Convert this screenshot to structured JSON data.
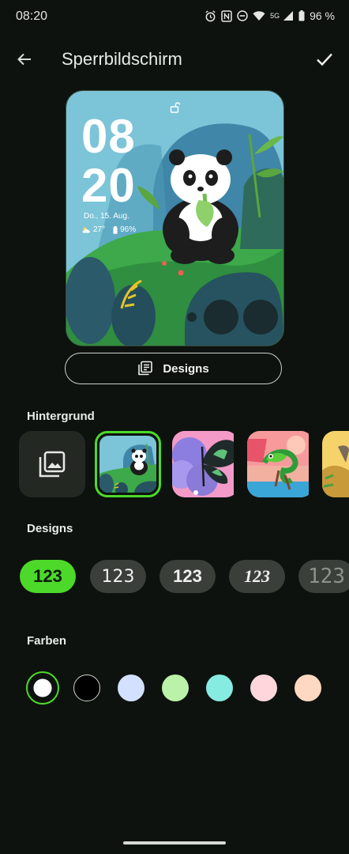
{
  "status_bar": {
    "time": "08:20",
    "network": "5G",
    "battery": "96 %"
  },
  "app_bar": {
    "title": "Sperrbildschirm"
  },
  "preview": {
    "hour": "08",
    "minute": "20",
    "date": "Do., 15. Aug.",
    "temperature": "27°",
    "battery": "96%"
  },
  "designs_button": {
    "label": "Designs"
  },
  "sections": {
    "background": "Hintergrund",
    "designs": "Designs",
    "colors": "Farben"
  },
  "wallpapers": [
    "gallery-picker",
    "panda",
    "butterfly",
    "chameleon",
    "partial"
  ],
  "clock_styles": [
    {
      "label": "123",
      "selected": true
    },
    {
      "label": "123",
      "selected": false
    },
    {
      "label": "123",
      "selected": false
    },
    {
      "label": "123",
      "selected": false
    },
    {
      "label": "123",
      "selected": false
    }
  ],
  "colors": [
    "#ffffff",
    "#000000",
    "#d3e0ff",
    "#b9f2a8",
    "#86ebe0",
    "#ffd6dc",
    "#ffd8c2"
  ],
  "accent": "#4cd92a"
}
